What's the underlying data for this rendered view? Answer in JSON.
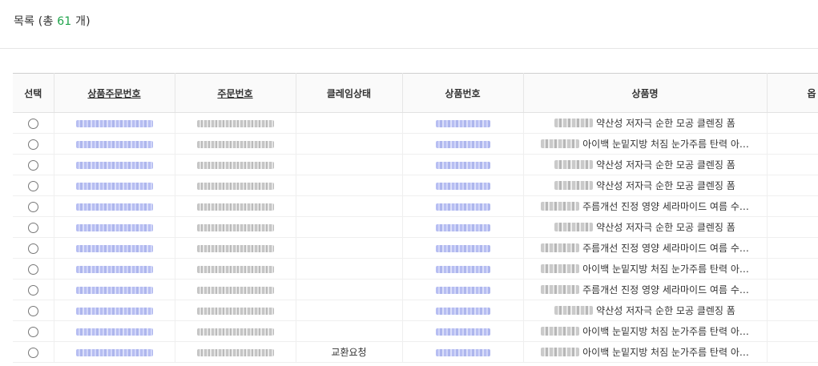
{
  "header": {
    "prefix": "목록 (총 ",
    "count": "61",
    "suffix": " 개)"
  },
  "table": {
    "columns": {
      "select": "선택",
      "product_order_no": "상품주문번호",
      "order_no": "주문번호",
      "claim_status": "클레임상태",
      "product_no": "상품번호",
      "product_name": "상품명",
      "option": "옵"
    },
    "rows": [
      {
        "claim": "",
        "name": "약산성 저자극 순한 모공 클렌징 폼"
      },
      {
        "claim": "",
        "name": "아이백 눈밑지방 처짐 눈가주름 탄력 아…"
      },
      {
        "claim": "",
        "name": "약산성 저자극 순한 모공 클렌징 폼"
      },
      {
        "claim": "",
        "name": "약산성 저자극 순한 모공 클렌징 폼"
      },
      {
        "claim": "",
        "name": "주름개선 진정 영양 세라마이드 여름 수…"
      },
      {
        "claim": "",
        "name": "약산성 저자극 순한 모공 클렌징 폼"
      },
      {
        "claim": "",
        "name": "주름개선 진정 영양 세라마이드 여름 수…"
      },
      {
        "claim": "",
        "name": "아이백 눈밑지방 처짐 눈가주름 탄력 아…"
      },
      {
        "claim": "",
        "name": "주름개선 진정 영양 세라마이드 여름 수…"
      },
      {
        "claim": "",
        "name": "약산성 저자극 순한 모공 클렌징 폼"
      },
      {
        "claim": "",
        "name": "아이백 눈밑지방 처짐 눈가주름 탄력 아…"
      },
      {
        "claim": "교환요청",
        "name": "아이백 눈밑지방 처짐 눈가주름 탄력 아…"
      }
    ]
  }
}
